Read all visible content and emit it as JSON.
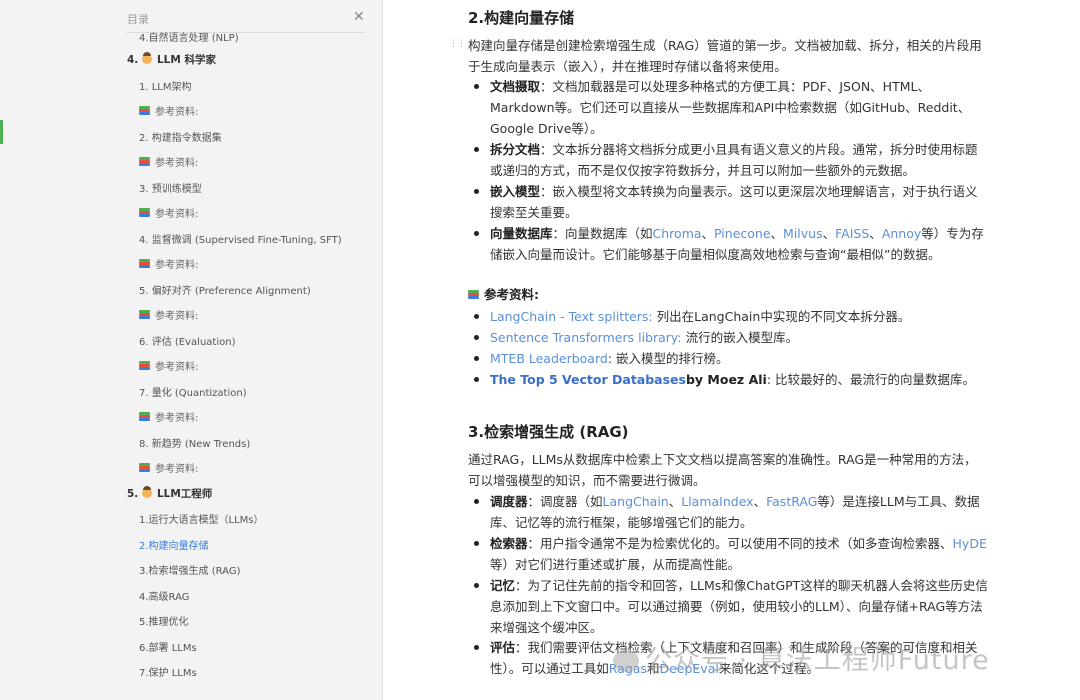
{
  "sidebar": {
    "title": "目录",
    "close_icon": "close-icon",
    "items": [
      {
        "label": "4.自然语言处理 (NLP)",
        "level": "l2",
        "icon": ""
      },
      {
        "label": "4. LLM 科学家",
        "level": "l1",
        "icon": "scientist-emoji"
      },
      {
        "label": "1. LLM架构",
        "level": "l2",
        "icon": ""
      },
      {
        "label": "参考资料:",
        "level": "l3",
        "icon": "books-emoji"
      },
      {
        "label": "2. 构建指令数据集",
        "level": "l2",
        "icon": ""
      },
      {
        "label": "参考资料:",
        "level": "l3",
        "icon": "books-emoji"
      },
      {
        "label": "3. 预训练模型",
        "level": "l2",
        "icon": ""
      },
      {
        "label": "参考资料:",
        "level": "l3",
        "icon": "books-emoji"
      },
      {
        "label": "4. 监督微调 (Supervised Fine-Tuning, SFT)",
        "level": "l2",
        "icon": ""
      },
      {
        "label": "参考资料:",
        "level": "l3",
        "icon": "books-emoji"
      },
      {
        "label": "5. 偏好对齐 (Preference Alignment)",
        "level": "l2",
        "icon": ""
      },
      {
        "label": "参考资料:",
        "level": "l3",
        "icon": "books-emoji"
      },
      {
        "label": "6. 评估 (Evaluation)",
        "level": "l2",
        "icon": ""
      },
      {
        "label": "参考资料:",
        "level": "l3",
        "icon": "books-emoji"
      },
      {
        "label": "7. 量化 (Quantization)",
        "level": "l2",
        "icon": ""
      },
      {
        "label": "参考资料:",
        "level": "l3",
        "icon": "books-emoji"
      },
      {
        "label": "8. 新趋势 (New Trends)",
        "level": "l2",
        "icon": ""
      },
      {
        "label": "参考资料:",
        "level": "l3",
        "icon": "books-emoji"
      },
      {
        "label": "5. LLM工程师",
        "level": "l1",
        "icon": "engineer-emoji"
      },
      {
        "label": "1.运行大语言模型（LLMs）",
        "level": "l2",
        "icon": ""
      },
      {
        "label": "2.构建向量存储",
        "level": "l2",
        "icon": "",
        "active": true
      },
      {
        "label": "3.检索增强生成 (RAG)",
        "level": "l2",
        "icon": ""
      },
      {
        "label": "4.高级RAG",
        "level": "l2",
        "icon": ""
      },
      {
        "label": "5.推理优化",
        "level": "l2",
        "icon": ""
      },
      {
        "label": "6.部署 LLMs",
        "level": "l2",
        "icon": ""
      },
      {
        "label": "7.保护 LLMs",
        "level": "l2",
        "icon": ""
      }
    ]
  },
  "content": {
    "sec1_title": "2.构建向量存储",
    "sec1_intro_1": "构建向量存储是创建检索增强生成（RAG）管道的第一步。文档被加载、拆分，相关的片段用",
    "sec1_intro_2": "于生成向量表示（嵌入），并在推理时存储以备将来使用。",
    "b1_label": "文档摄取",
    "b1_text": "：文档加载器是可以处理多种格式的方便工具：PDF、JSON、HTML、Markdown等。它们还可以直接从一些数据库和API中检索数据（如GitHub、Reddit、Google Drive等）。",
    "b2_label": "拆分文档",
    "b2_text": "：文本拆分器将文档拆分成更小且具有语义意义的片段。通常，拆分时使用标题或递归的方式，而不是仅仅按字符数拆分，并且可以附加一些额外的元数据。",
    "b3_label": "嵌入模型",
    "b3_text": "：嵌入模型将文本转换为向量表示。这可以更深层次地理解语言，对于执行语义搜索至关重要。",
    "b4_label": "向量数据库",
    "b4_pre": "：向量数据库（如",
    "b4_links": [
      "Chroma",
      "Pinecone",
      "Milvus",
      "FAISS",
      "Annoy"
    ],
    "b4_sep": "、",
    "b4_post": "等）专为存储嵌入向量而设计。它们能够基于向量相似度高效地检索与查询“最相似”的数据。",
    "refs_label": "参考资料:",
    "ref1_link": "LangChain - Text splitters:",
    "ref1_text": " 列出在LangChain中实现的不同文本拆分器。",
    "ref2_link": "Sentence Transformers library:",
    "ref2_text": " 流行的嵌入模型库。",
    "ref3_link": "MTEB Leaderboard",
    "ref3_text": ": 嵌入模型的排行榜。",
    "ref4_link": "The Top 5 Vector Databases",
    "ref4_by": "by Moez Ali",
    "ref4_text": ": 比较最好的、最流行的向量数据库。",
    "sec2_title": "3.检索增强生成 (RAG)",
    "sec2_intro_1": "通过RAG，LLMs从数据库中检索上下文文档以提高答案的准确性。RAG是一种常用的方法，",
    "sec2_intro_2": "可以增强模型的知识，而不需要进行微调。",
    "c1_label": "调度器",
    "c1_pre": "：调度器（如",
    "c1_links": [
      "LangChain",
      "LlamaIndex",
      "FastRAG"
    ],
    "c1_post": "等）是连接LLM与工具、数据库、记忆等的流行框架，能够增强它们的能力。",
    "c2_label": "检索器",
    "c2_pre": "：用户指令通常不是为检索优化的。可以使用不同的技术（如多查询检索器、",
    "c2_link": "HyDE",
    "c2_post": "等）对它们进行重述或扩展，从而提高性能。",
    "c3_label": "记忆",
    "c3_text": "：为了记住先前的指令和回答，LLMs和像ChatGPT这样的聊天机器人会将这些历史信息添加到上下文窗口中。可以通过摘要（例如，使用较小的LLM）、向量存储+RAG等方法来增强这个缓冲区。",
    "c4_label": "评估",
    "c4_pre": "：我们需要评估文档检索（上下文精度和召回率）和生成阶段（答案的可信度和相关性）。可以通过工具如",
    "c4_link1": "Ragas",
    "c4_mid": "和",
    "c4_link2": "DeepEval",
    "c4_post": "来简化这个过程。",
    "watermark": "公众号 · 算法工程师Future"
  }
}
